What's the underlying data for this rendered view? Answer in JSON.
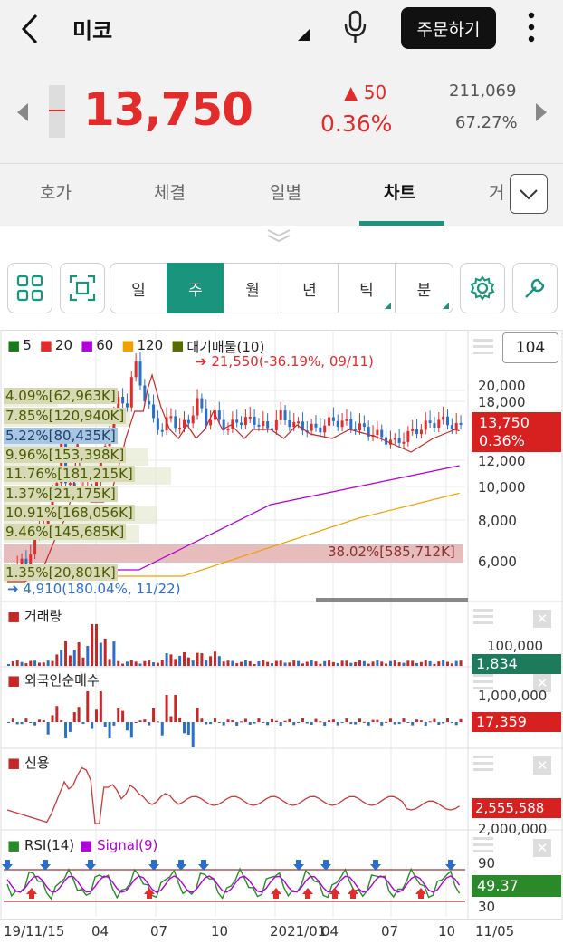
{
  "header": {
    "stock_name": "미코",
    "order_button": "주문하기"
  },
  "quote": {
    "price": "13,750",
    "change": "▲ 50",
    "change_pct": "0.36%",
    "volume": "211,069",
    "volume_ratio": "67.27%"
  },
  "tabs": [
    "호가",
    "체결",
    "일별",
    "차트",
    "거"
  ],
  "periods": [
    "일",
    "주",
    "월",
    "년",
    "틱",
    "분"
  ],
  "chart": {
    "count": "104",
    "ma_legend": [
      {
        "label": "5",
        "color": "#1a7a1a"
      },
      {
        "label": "20",
        "color": "#e32b2b"
      },
      {
        "label": "60",
        "color": "#b000d8"
      },
      {
        "label": "120",
        "color": "#f0a000"
      },
      {
        "label": "대기매물(10)",
        "color": "#556b00"
      }
    ],
    "high_note": "21,550(-36.19%, 09/11)",
    "low_note": "4,910(180.04%, 11/22)",
    "overhang": [
      "4.09%[62,963K]",
      "7.85%[120,940K]",
      "5.22%[80,435K]",
      "9.96%[153,398K]",
      "11.76%[181,215K]",
      "1.37%[21,175K]",
      "10.91%[168,056K]",
      "9.46%[145,685K]",
      "38.02%[585,712K]",
      "1.35%[20,801K]"
    ],
    "price_axis": [
      "20,000",
      "18,000",
      "12,000",
      "10,000",
      "8,000",
      "6,000"
    ],
    "last_price": "13,750",
    "last_pct": "0.36%",
    "volume": {
      "title": "거래량",
      "axis": "100,000",
      "value": "1,834"
    },
    "foreign": {
      "title": "외국인순매수",
      "axis": "1,000,000",
      "value": "17,359"
    },
    "credit": {
      "title": "신용",
      "axis": "2,000,000",
      "value": "2,555,588"
    },
    "rsi": {
      "title": "RSI(14)",
      "signal": "Signal(9)",
      "axis_top": "90",
      "axis_bottom": "30",
      "value": "49.37"
    },
    "x_axis": [
      "19/11/15",
      "04",
      "07",
      "10",
      "2021/01",
      "04",
      "07",
      "10",
      "11/05"
    ]
  }
}
